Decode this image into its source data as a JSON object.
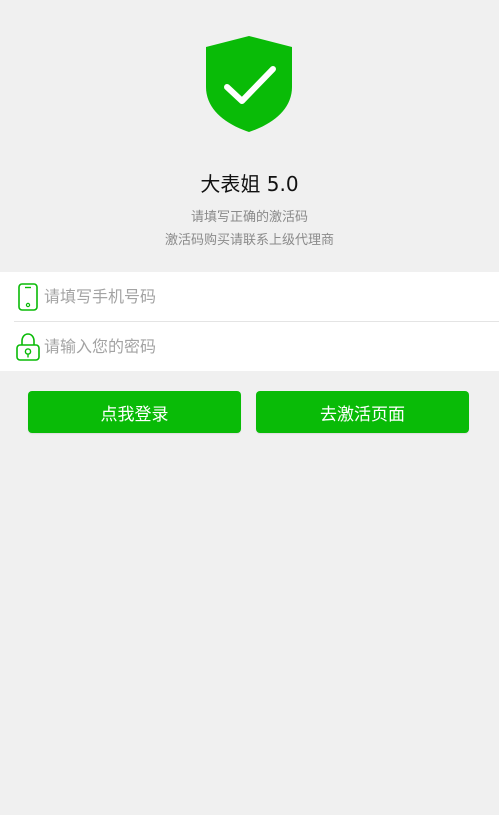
{
  "app": {
    "title": "大表姐 5.0",
    "subtitle_line1": "请填写正确的激活码",
    "subtitle_line2": "激活码购买请联系上级代理商"
  },
  "form": {
    "phone": {
      "placeholder": "请填写手机号码",
      "value": "",
      "icon": "phone-icon"
    },
    "password": {
      "placeholder": "请输入您的密码",
      "value": "",
      "icon": "lock-icon"
    }
  },
  "buttons": {
    "login_label": "点我登录",
    "activate_label": "去激活页面"
  },
  "colors": {
    "accent": "#09bb07",
    "background": "#f0f0f0",
    "muted_text": "#8a8a8a"
  },
  "logo": {
    "icon": "shield-check-icon"
  }
}
